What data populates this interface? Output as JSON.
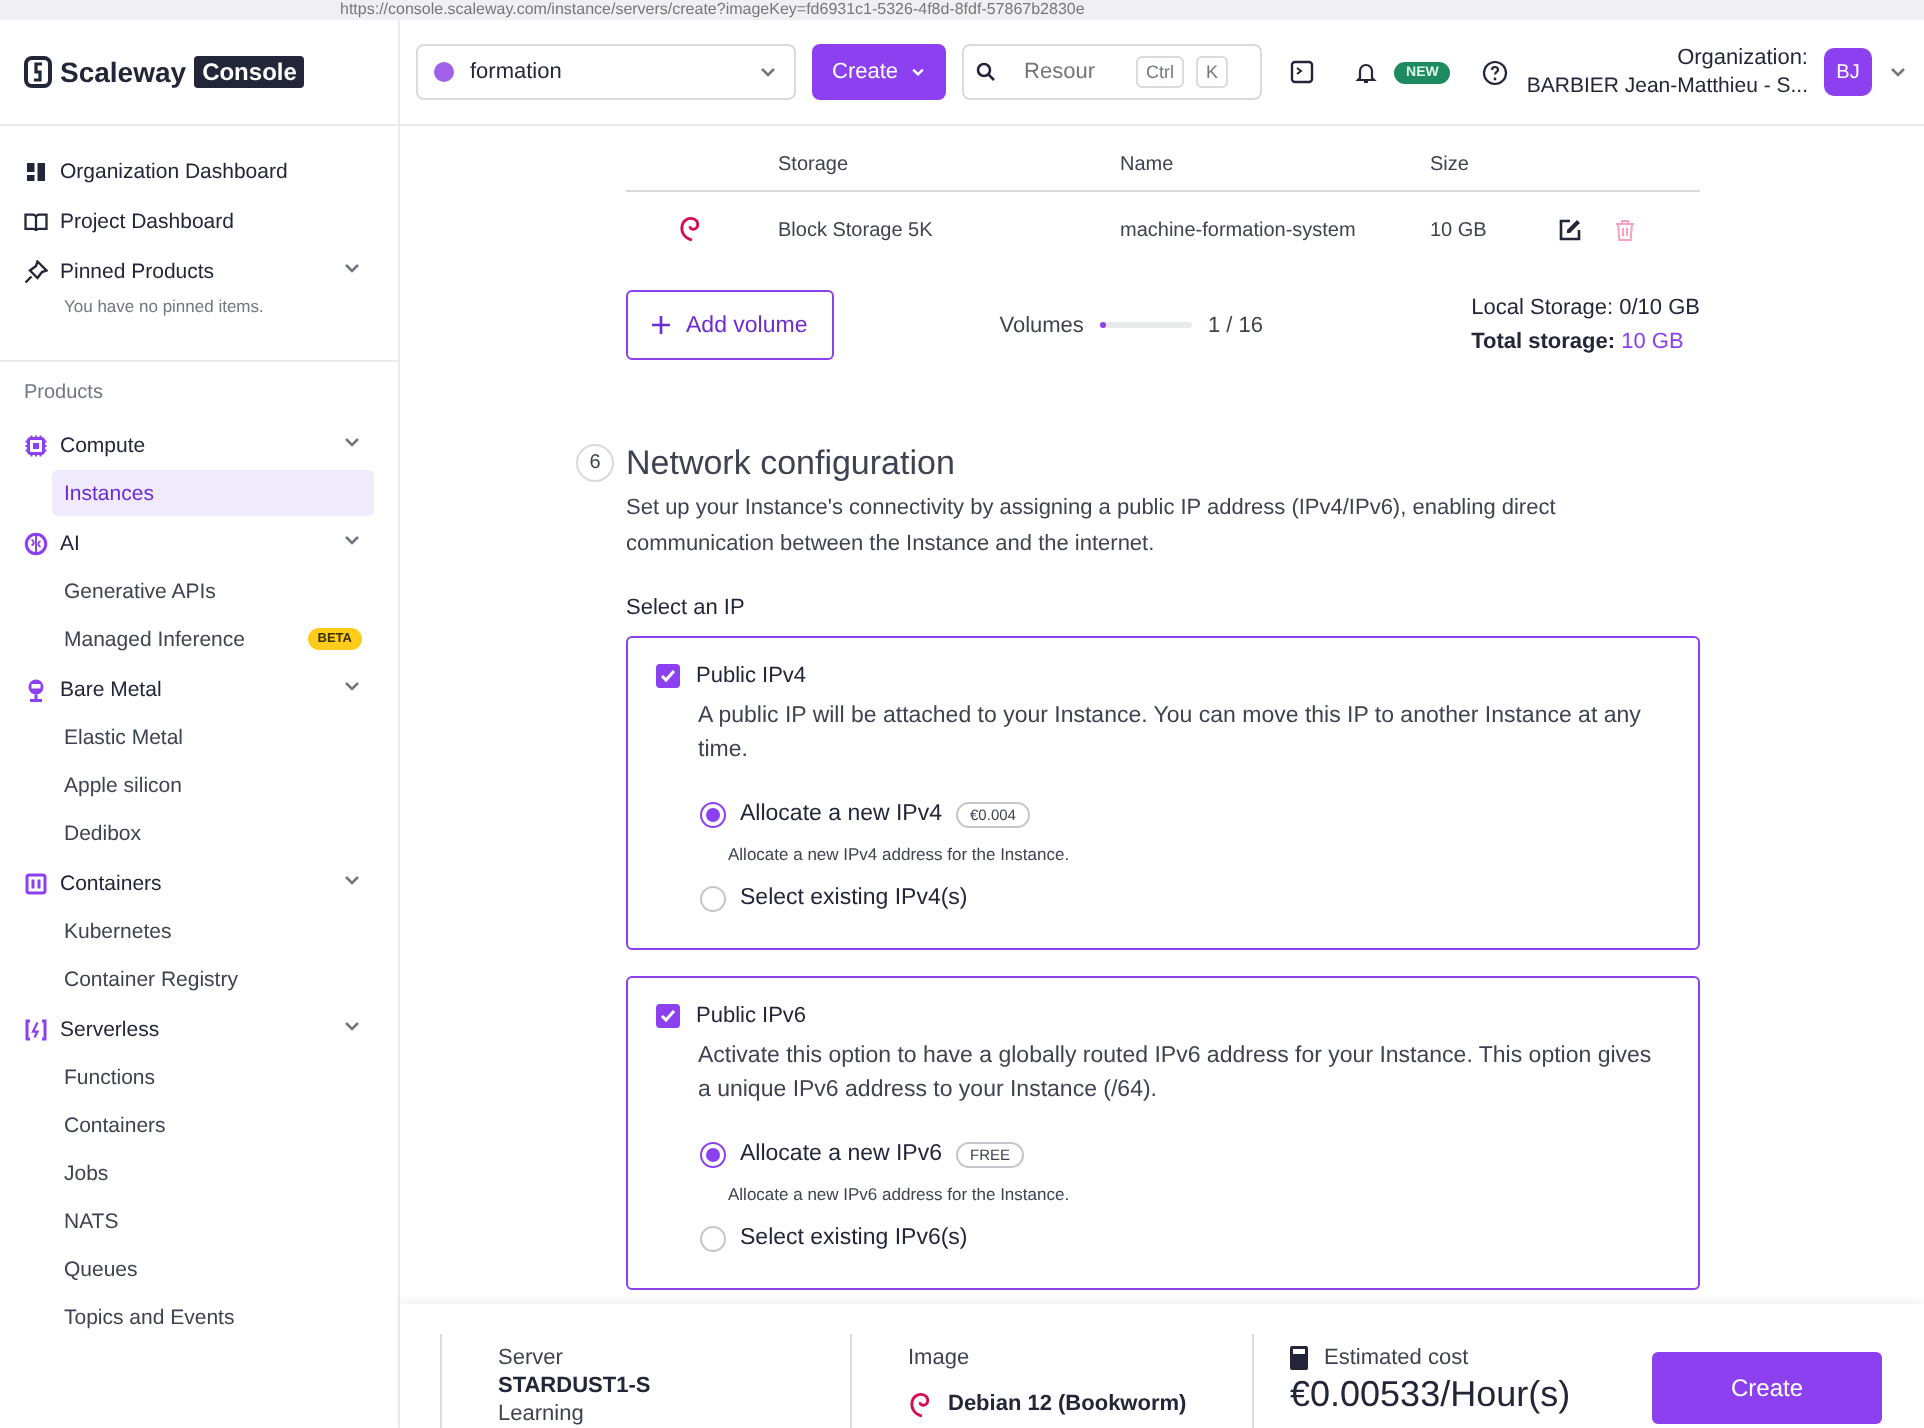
{
  "browser": {
    "url": "https://console.scaleway.com/instance/servers/create?imageKey=fd6931c1-5326-4f8d-8fdf-57867b2830e"
  },
  "header": {
    "logo": "Scaleway",
    "logo_badge": "Console",
    "project": "formation",
    "create_button": "Create",
    "search": {
      "placeholder": "Resour",
      "keys": [
        "Ctrl",
        "K"
      ]
    },
    "new_badge": "NEW",
    "org_label": "Organization:",
    "org_name": "BARBIER Jean-Matthieu - S...",
    "avatar": "BJ"
  },
  "sidebar": {
    "top_items": [
      {
        "label": "Organization Dashboard"
      },
      {
        "label": "Project Dashboard"
      },
      {
        "label": "Pinned Products",
        "expanded": true
      }
    ],
    "pinned_empty": "You have no pinned items.",
    "products_label": "Products",
    "groups": [
      {
        "label": "Compute",
        "expanded": true,
        "children": [
          {
            "label": "Instances",
            "selected": true
          }
        ]
      },
      {
        "label": "AI",
        "expanded": true,
        "children": [
          {
            "label": "Generative APIs",
            "selected": false
          },
          {
            "label": "Managed Inference",
            "selected": false,
            "badge": "BETA"
          }
        ]
      },
      {
        "label": "Bare Metal",
        "expanded": true,
        "children": [
          {
            "label": "Elastic Metal",
            "selected": false
          },
          {
            "label": "Apple silicon",
            "selected": false
          },
          {
            "label": "Dedibox",
            "selected": false
          }
        ]
      },
      {
        "label": "Containers",
        "expanded": true,
        "children": [
          {
            "label": "Kubernetes",
            "selected": false
          },
          {
            "label": "Container Registry",
            "selected": false
          }
        ]
      },
      {
        "label": "Serverless",
        "expanded": true,
        "children": [
          {
            "label": "Functions",
            "selected": false
          },
          {
            "label": "Containers",
            "selected": false
          },
          {
            "label": "Jobs",
            "selected": false
          },
          {
            "label": "NATS",
            "selected": false
          },
          {
            "label": "Queues",
            "selected": false
          },
          {
            "label": "Topics and Events",
            "selected": false
          }
        ]
      }
    ]
  },
  "storage": {
    "columns": [
      "Storage",
      "Name",
      "Size"
    ],
    "rows": [
      {
        "storage": "Block Storage 5K",
        "name": "machine-formation-system",
        "size": "10 GB"
      }
    ],
    "add_volume": "Add volume",
    "volumes": {
      "label": "Volumes",
      "level": 0.0625,
      "reading": "1 / 16"
    },
    "local_storage": "Local Storage: 0/10 GB",
    "total_label": "Total storage:",
    "total_value": "10 GB"
  },
  "network": {
    "step": "6",
    "title": "Network configuration",
    "description": "Set up your Instance's connectivity by assigning a public IP address (IPv4/IPv6), enabling direct communication between the Instance and the internet.",
    "select_label": "Select an IP",
    "options": [
      {
        "label": "Public IPv4",
        "checked": true,
        "description": "A public IP will be attached to your Instance. You can move this IP to another Instance at any time.",
        "choices": [
          {
            "label": "Allocate a new IPv4",
            "badge": "€0.004",
            "selected": true,
            "hint": "Allocate a new IPv4 address for the Instance."
          },
          {
            "label": "Select existing IPv4(s)",
            "selected": false
          }
        ]
      },
      {
        "label": "Public IPv6",
        "checked": true,
        "description": "Activate this option to have a globally routed IPv6 address for your Instance. This option gives a unique IPv6 address to your Instance (/64).",
        "choices": [
          {
            "label": "Allocate a new IPv6",
            "badge": "FREE",
            "selected": true,
            "hint": "Allocate a new IPv6 address for the Instance."
          },
          {
            "label": "Select existing IPv6(s)",
            "selected": false
          }
        ]
      }
    ]
  },
  "footer": {
    "server": {
      "label": "Server",
      "value": "STARDUST1-S",
      "sub": "Learning"
    },
    "image": {
      "label": "Image",
      "value": "Debian 12 (Bookworm)"
    },
    "cost": {
      "label": "Estimated cost",
      "value": "€0.00533/Hour(s)"
    },
    "create_button": "Create"
  }
}
